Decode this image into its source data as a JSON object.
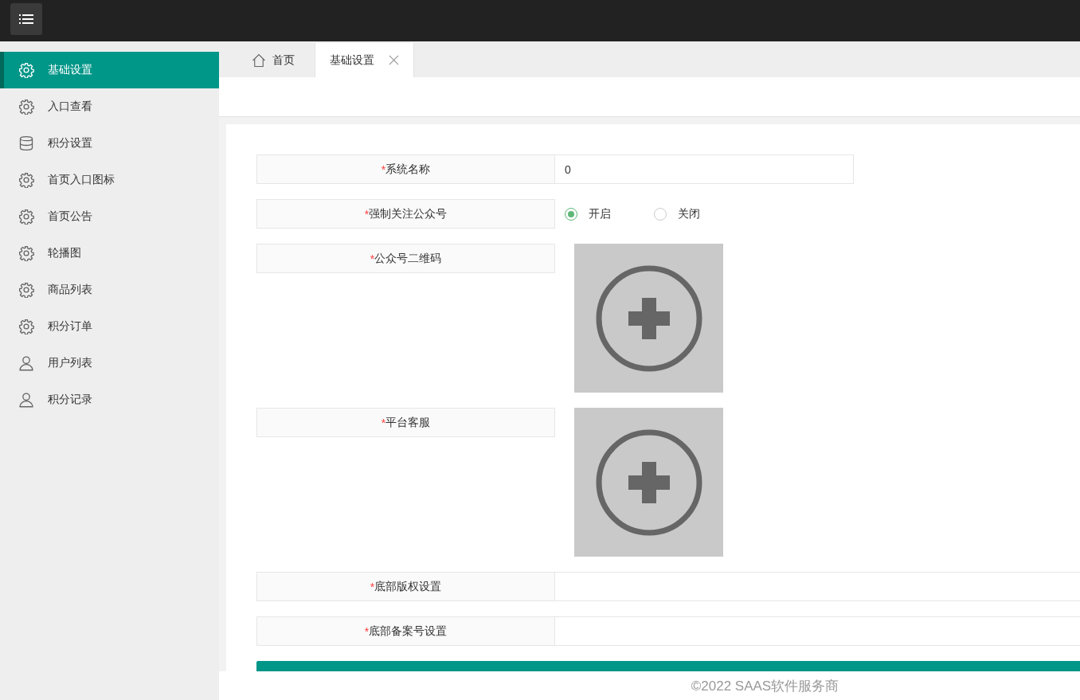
{
  "sidebar": {
    "items": [
      {
        "label": "基础设置",
        "kind": "gear",
        "selected": true
      },
      {
        "label": "入口查看",
        "kind": "gear",
        "selected": false
      },
      {
        "label": "积分设置",
        "kind": "database",
        "selected": false
      },
      {
        "label": "首页入口图标",
        "kind": "gear",
        "selected": false
      },
      {
        "label": "首页公告",
        "kind": "gear",
        "selected": false
      },
      {
        "label": "轮播图",
        "kind": "gear",
        "selected": false
      },
      {
        "label": "商品列表",
        "kind": "gear",
        "selected": false
      },
      {
        "label": "积分订单",
        "kind": "gear",
        "selected": false
      },
      {
        "label": "用户列表",
        "kind": "user",
        "selected": false
      },
      {
        "label": "积分记录",
        "kind": "user",
        "selected": false
      }
    ]
  },
  "tabs": [
    {
      "label": "首页",
      "kind": "home",
      "selected": false
    },
    {
      "label": "基础设置",
      "kind": "closable",
      "selected": true
    }
  ],
  "form": {
    "rows": [
      {
        "mark": "*",
        "label": "系统名称",
        "kind": "short_text",
        "value": "0"
      },
      {
        "mark": "*",
        "label": "强制关注公众号",
        "kind": "radio",
        "options": [
          {
            "label": "开启",
            "selected": true
          },
          {
            "label": "关闭",
            "selected": false
          }
        ]
      },
      {
        "mark": "*",
        "label": "公众号二维码",
        "kind": "upload"
      },
      {
        "mark": "*",
        "label": "平台客服",
        "kind": "upload"
      },
      {
        "mark": "*",
        "label": "底部版权设置",
        "kind": "long_text"
      },
      {
        "mark": "*",
        "label": "底部备案号设置",
        "kind": "long_text"
      }
    ]
  },
  "footer": {
    "text": "©2022 SAAS软件服务商"
  }
}
